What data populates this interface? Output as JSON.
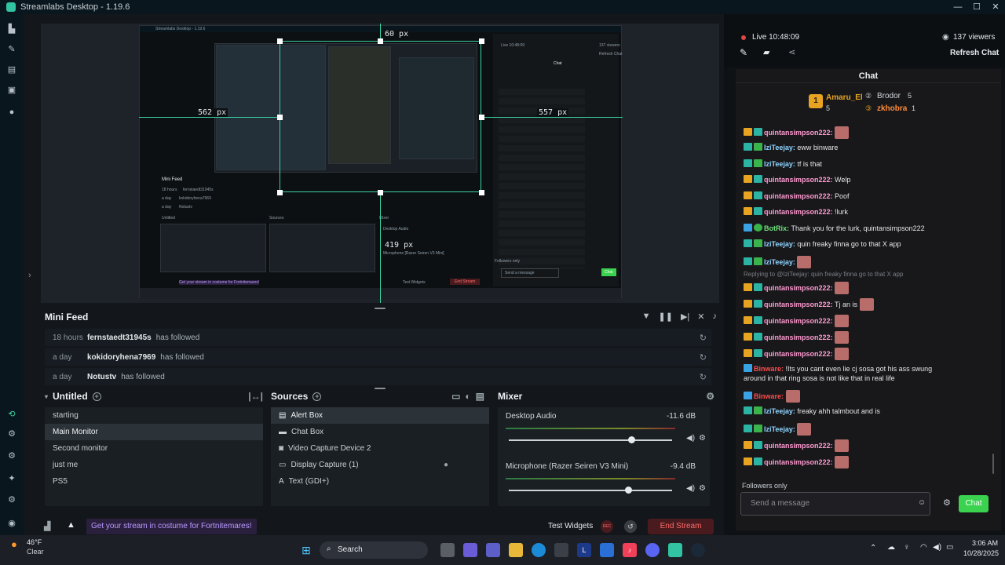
{
  "app": {
    "title": "Streamlabs Desktop - 1.19.6"
  },
  "preview": {
    "dim_top": "60 px",
    "dim_left": "562 px",
    "dim_right": "557 px",
    "dim_bottom": "419 px",
    "nested_title": "Streamlabs Desktop - 1.19.6",
    "nested_chat_title": "Chat",
    "nested_live": "Live 10:48:09",
    "nested_viewers": "137 viewers",
    "nested_refresh": "Refresh Chat",
    "nested_minifeed": "Mini Feed",
    "nested_sources": "Sources",
    "nested_mixer": "Mixer",
    "nested_untitled": "Untitled",
    "nested_desktop_audio": "Desktop Audio",
    "nested_mic": "Microphone [Razer Seiren V3 Mini]",
    "nested_promo": "Get your stream in costume for Fortnitemares!",
    "nested_end": "End Stream",
    "nested_test": "Test Widgets",
    "nested_send": "Send a message",
    "nested_followers": "Followers only",
    "nested_chatbtn": "Chat",
    "nested_mini_rows": [
      {
        "time": "18 hours",
        "user": "fernstaedt31945s",
        "action": "has followed"
      },
      {
        "time": "a day",
        "user": "kokidoryhena7969",
        "action": "has followed"
      },
      {
        "time": "a day",
        "user": "Notustv",
        "action": "has followed"
      }
    ]
  },
  "minifeed": {
    "title": "Mini Feed",
    "rows": [
      {
        "time": "18 hours",
        "user": "fernstaedt31945s",
        "action": "has followed"
      },
      {
        "time": "a day",
        "user": "kokidoryhena7969",
        "action": "has followed"
      },
      {
        "time": "a day",
        "user": "Notustv",
        "action": "has followed"
      }
    ]
  },
  "scenes": {
    "title": "Untitled",
    "items": [
      "starting",
      "Main Monitor",
      "Second monitor",
      "just me",
      "PS5"
    ],
    "selected": 1
  },
  "sources": {
    "title": "Sources",
    "items": [
      {
        "label": "Alert Box",
        "icon": "alert-box-icon"
      },
      {
        "label": "Chat Box",
        "icon": "chat-box-icon"
      },
      {
        "label": "Video Capture Device 2",
        "icon": "camera-icon"
      },
      {
        "label": "Display Capture (1)",
        "icon": "monitor-icon"
      },
      {
        "label": "Text (GDI+)",
        "icon": "text-icon"
      }
    ],
    "selected": 0
  },
  "mixer": {
    "title": "Mixer",
    "channels": [
      {
        "name": "Desktop Audio",
        "db": "-11.6 dB",
        "level": 0.75
      },
      {
        "name": "Microphone (Razer Seiren V3 Mini)",
        "db": "-9.4 dB",
        "level": 0.73
      }
    ]
  },
  "footer": {
    "promo": "Get your stream in costume for Fortnitemares!",
    "test_widgets": "Test Widgets",
    "end_stream": "End Stream"
  },
  "chat_panel": {
    "live": "Live 10:48:09",
    "viewers": "137 viewers",
    "refresh": "Refresh Chat",
    "title": "Chat",
    "top_user": "Amaru_El",
    "top_user_count": "5",
    "leader2": "Brodor",
    "leader2_count": "5",
    "leader3": "zkhobra",
    "leader3_count": "1",
    "reply_note": "Replying to @IziTeejay: quin freaky finna go to that X app",
    "followers_only": "Followers only",
    "placeholder": "Send a message",
    "chat_button": "Chat",
    "messages": [
      {
        "user": "quintansimpson222:",
        "text": "",
        "emote": true,
        "type": "crown"
      },
      {
        "user": "IziTeejay:",
        "text": "eww binware",
        "emote": false,
        "type": "mod"
      },
      {
        "user": "IziTeejay:",
        "text": "tf is that",
        "emote": false,
        "type": "mod"
      },
      {
        "user": "quintansimpson222:",
        "text": "Welp",
        "emote": false,
        "type": "crown"
      },
      {
        "user": "quintansimpson222:",
        "text": "Poof",
        "emote": false,
        "type": "crown"
      },
      {
        "user": "quintansimpson222:",
        "text": "!lurk",
        "emote": false,
        "type": "crown"
      },
      {
        "user": "BotRix:",
        "text": "Thank you for the lurk, quintansimpson222",
        "emote": false,
        "type": "bot"
      },
      {
        "user": "IziTeejay:",
        "text": "quin freaky finna go to that X app",
        "emote": false,
        "type": "mod"
      },
      {
        "user": "IziTeejay:",
        "text": "",
        "emote": true,
        "type": "mod"
      },
      {
        "user": "quintansimpson222:",
        "text": "",
        "emote": true,
        "type": "crown"
      },
      {
        "user": "quintansimpson222:",
        "text": "Tj an is",
        "emote": true,
        "type": "crown"
      },
      {
        "user": "quintansimpson222:",
        "text": "",
        "emote": true,
        "type": "crown"
      },
      {
        "user": "quintansimpson222:",
        "text": "",
        "emote": true,
        "type": "crown"
      },
      {
        "user": "quintansimpson222:",
        "text": "",
        "emote": true,
        "type": "crown"
      },
      {
        "user": "Binware:",
        "text": "!Its you cant even lie cj sosa got his ass swung",
        "text2": "around in that ring sosa is not like that in real life",
        "emote": false,
        "type": "sub"
      },
      {
        "user": "Binware:",
        "text": "",
        "emote": true,
        "type": "sub"
      },
      {
        "user": "IziTeejay:",
        "text": "freaky ahh talmbout and is",
        "emote": false,
        "type": "mod"
      },
      {
        "user": "IziTeejay:",
        "text": "",
        "emote": true,
        "type": "mod"
      },
      {
        "user": "quintansimpson222:",
        "text": "",
        "emote": true,
        "type": "crown"
      },
      {
        "user": "quintansimpson222:",
        "text": "",
        "emote": true,
        "type": "crown"
      }
    ]
  },
  "taskbar": {
    "weather_temp": "46°F",
    "weather_desc": "Clear",
    "search": "Search",
    "time": "3:06 AM",
    "date": "10/28/2025"
  },
  "colors": {
    "accent": "#3ad29f",
    "chat_button": "#3ad24e",
    "end_stream": "#ff6b6b",
    "promo": "#b89cff"
  }
}
